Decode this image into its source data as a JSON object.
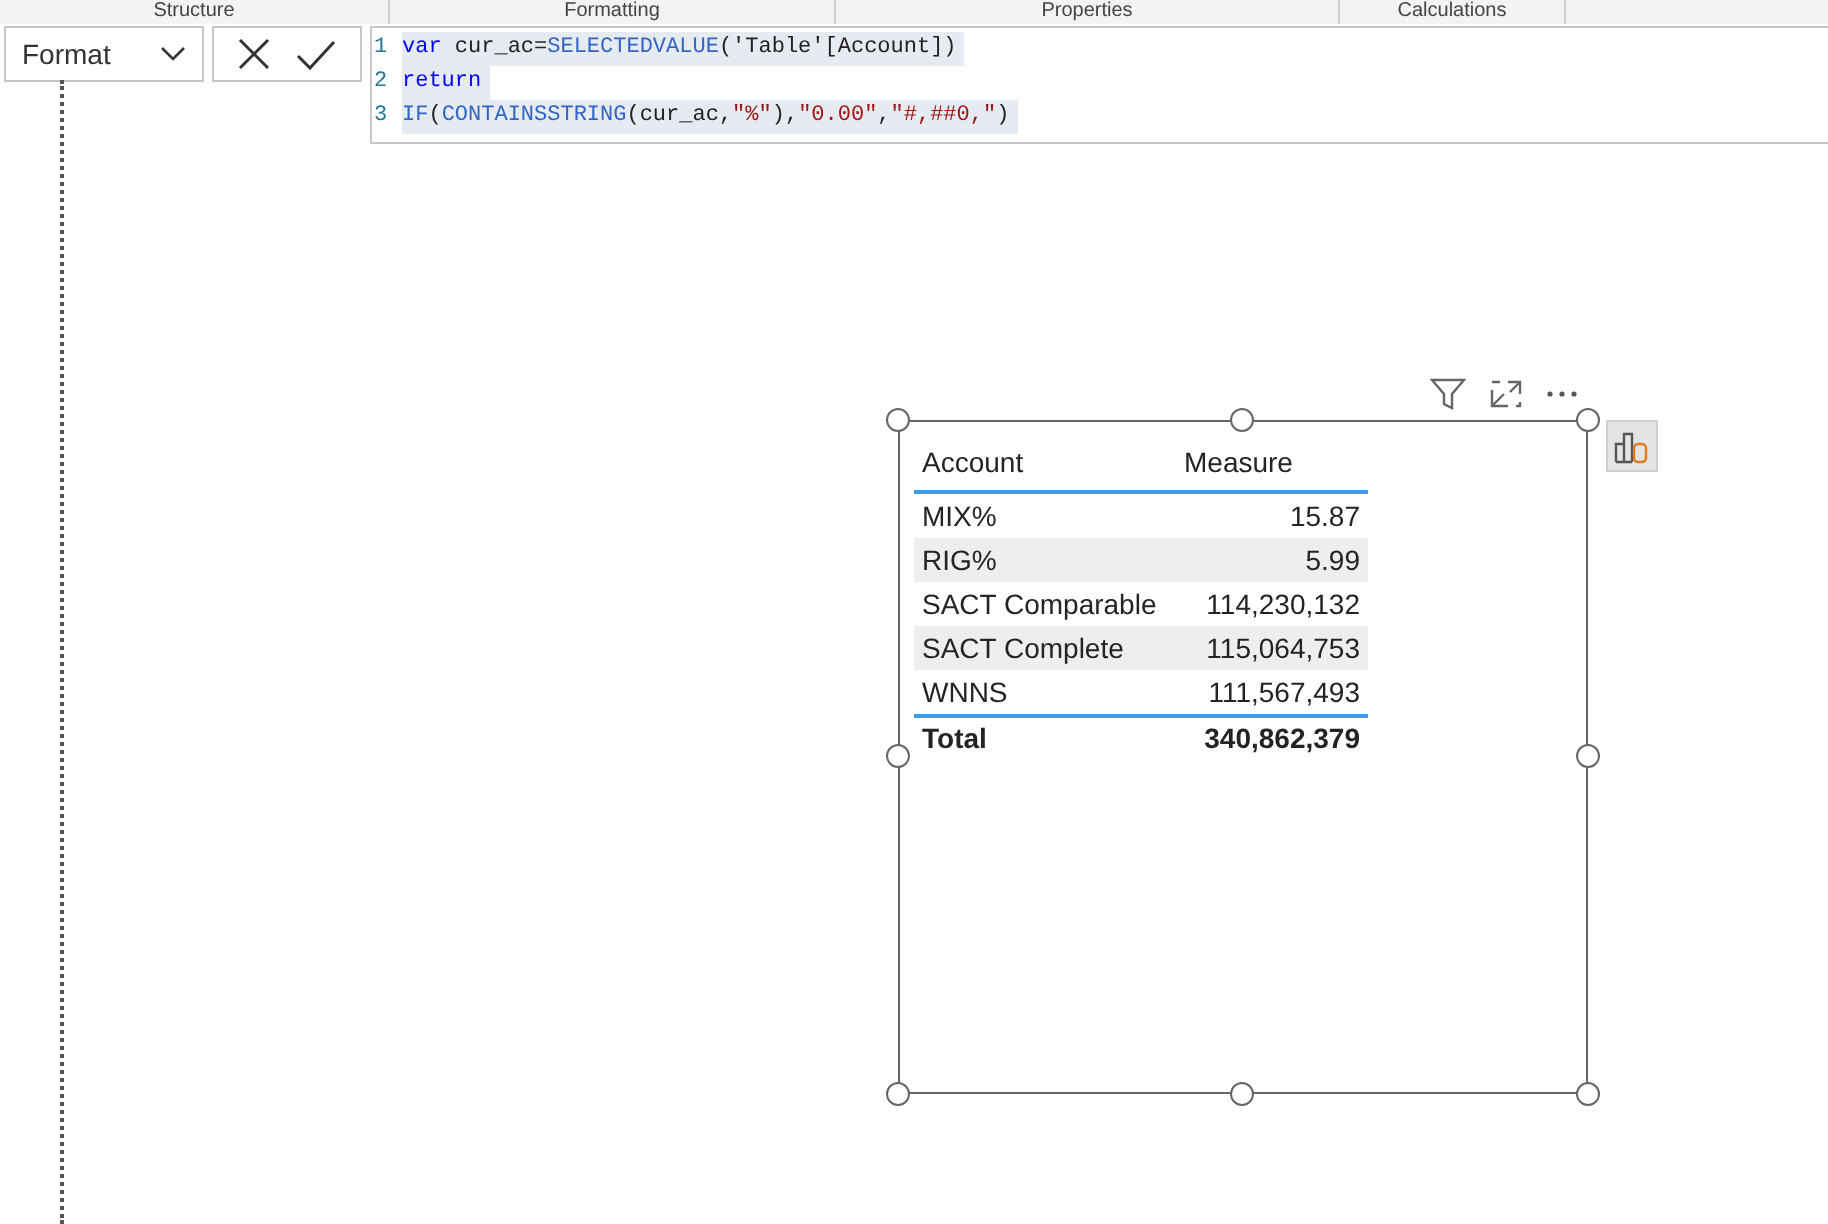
{
  "ribbon_groups": [
    "Structure",
    "Formatting",
    "Properties",
    "Calculations"
  ],
  "property_dropdown": {
    "value": "Format"
  },
  "formula_bar": {
    "lines": [
      {
        "number": "1",
        "tokens": [
          {
            "kind": "keyword",
            "text": "var"
          },
          {
            "kind": "plain",
            "text": " cur_ac="
          },
          {
            "kind": "function",
            "text": "SELECTEDVALUE"
          },
          {
            "kind": "plain",
            "text": "('Table'[Account])"
          }
        ]
      },
      {
        "number": "2",
        "tokens": [
          {
            "kind": "keyword",
            "text": "return"
          }
        ]
      },
      {
        "number": "3",
        "tokens": [
          {
            "kind": "function",
            "text": "IF"
          },
          {
            "kind": "plain",
            "text": "("
          },
          {
            "kind": "function",
            "text": "CONTAINSSTRING"
          },
          {
            "kind": "plain",
            "text": "(cur_ac,"
          },
          {
            "kind": "string",
            "text": "\"%\""
          },
          {
            "kind": "plain",
            "text": "),"
          },
          {
            "kind": "string",
            "text": "\"0.00\""
          },
          {
            "kind": "plain",
            "text": ","
          },
          {
            "kind": "string",
            "text": "\"#,##0,\""
          },
          {
            "kind": "plain",
            "text": ")"
          }
        ]
      }
    ]
  },
  "table_visual": {
    "columns": [
      "Account",
      "Measure"
    ],
    "rows": [
      {
        "account": "MIX%",
        "measure": "15.87"
      },
      {
        "account": "RIG%",
        "measure": "5.99"
      },
      {
        "account": "SACT Comparable",
        "measure": "114,230,132"
      },
      {
        "account": "SACT Complete",
        "measure": "115,064,753"
      },
      {
        "account": "WNNS",
        "measure": "111,567,493"
      }
    ],
    "total": {
      "label": "Total",
      "value": "340,862,379"
    }
  }
}
